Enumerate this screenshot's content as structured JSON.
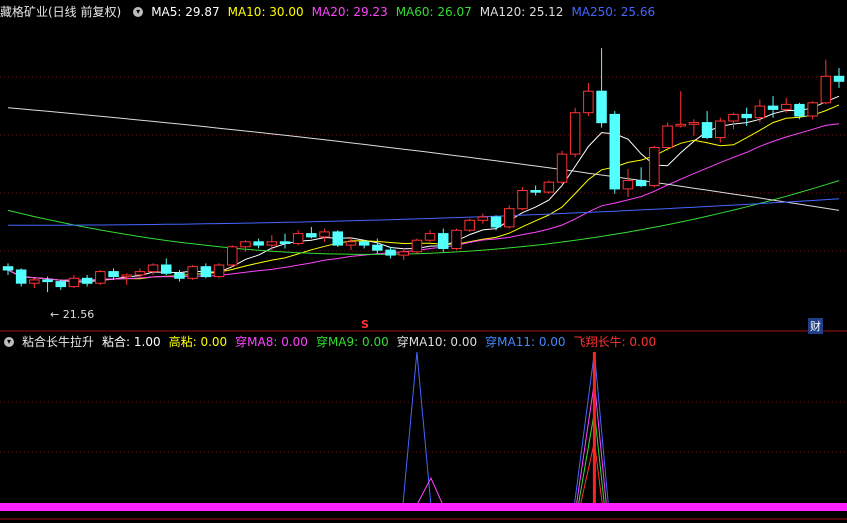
{
  "top_panel": {
    "title": "藏格矿业(日线 前复权)",
    "ma_items": [
      {
        "label": "MA5: 29.87",
        "color": "#ffffff"
      },
      {
        "label": "MA10: 30.00",
        "color": "#ffff00"
      },
      {
        "label": "MA20: 29.23",
        "color": "#ff44ff"
      },
      {
        "label": "MA60: 26.07",
        "color": "#33dd33"
      },
      {
        "label": "MA120: 25.12",
        "color": "#dddddd"
      },
      {
        "label": "MA250: 25.66",
        "color": "#4466ff"
      }
    ],
    "low_label": "← 21.56",
    "marker_s": "S",
    "marker_cai": "财"
  },
  "bottom_panel": {
    "title": "粘合长牛拉升",
    "items": [
      {
        "label": "粘合: 1.00",
        "color": "#ffffff"
      },
      {
        "label": "高粘: 0.00",
        "color": "#ffff00"
      },
      {
        "label": "穿MA8: 0.00",
        "color": "#ff44ff"
      },
      {
        "label": "穿MA9: 0.00",
        "color": "#33dd33"
      },
      {
        "label": "穿MA10: 0.00",
        "color": "#dddddd"
      },
      {
        "label": "穿MA11: 0.00",
        "color": "#4488ff"
      },
      {
        "label": "飞翔长牛: 0.00",
        "color": "#ff3333"
      }
    ]
  },
  "chart_data": {
    "type": "candlestick",
    "ylim": [
      20,
      38
    ],
    "candles": [
      [
        23.1,
        23.3,
        22.6,
        22.9
      ],
      [
        22.9,
        23.0,
        21.9,
        22.1
      ],
      [
        22.1,
        22.4,
        21.8,
        22.3
      ],
      [
        22.3,
        22.5,
        21.56,
        22.2
      ],
      [
        22.2,
        22.3,
        21.7,
        21.9
      ],
      [
        21.9,
        22.6,
        21.8,
        22.4
      ],
      [
        22.4,
        22.6,
        21.9,
        22.1
      ],
      [
        22.1,
        22.9,
        22.0,
        22.8
      ],
      [
        22.8,
        23.0,
        22.3,
        22.5
      ],
      [
        22.5,
        22.7,
        22.0,
        22.6
      ],
      [
        22.6,
        23.0,
        22.4,
        22.8
      ],
      [
        22.8,
        23.3,
        22.6,
        23.2
      ],
      [
        23.2,
        23.6,
        22.6,
        22.7
      ],
      [
        22.7,
        22.9,
        22.2,
        22.4
      ],
      [
        22.4,
        23.2,
        22.3,
        23.1
      ],
      [
        23.1,
        23.3,
        22.4,
        22.5
      ],
      [
        22.5,
        23.3,
        22.4,
        23.2
      ],
      [
        23.2,
        24.4,
        23.1,
        24.3
      ],
      [
        24.3,
        24.7,
        24.0,
        24.6
      ],
      [
        24.6,
        24.8,
        24.2,
        24.4
      ],
      [
        24.4,
        25.0,
        24.1,
        24.6
      ],
      [
        24.6,
        25.1,
        24.2,
        24.5
      ],
      [
        24.5,
        25.3,
        24.4,
        25.1
      ],
      [
        25.1,
        25.5,
        24.8,
        24.9
      ],
      [
        24.9,
        25.4,
        24.6,
        25.2
      ],
      [
        25.2,
        25.3,
        24.3,
        24.4
      ],
      [
        24.4,
        24.9,
        24.1,
        24.6
      ],
      [
        24.6,
        24.7,
        24.2,
        24.4
      ],
      [
        24.4,
        24.8,
        23.9,
        24.1
      ],
      [
        24.1,
        24.3,
        23.6,
        23.8
      ],
      [
        23.8,
        24.2,
        23.5,
        24.0
      ],
      [
        24.0,
        24.8,
        23.9,
        24.7
      ],
      [
        24.7,
        25.3,
        24.6,
        25.1
      ],
      [
        25.1,
        25.4,
        24.0,
        24.2
      ],
      [
        24.2,
        25.4,
        24.1,
        25.3
      ],
      [
        25.3,
        26.0,
        25.2,
        25.9
      ],
      [
        25.9,
        26.3,
        25.7,
        26.1
      ],
      [
        26.1,
        26.2,
        25.3,
        25.5
      ],
      [
        25.5,
        26.8,
        25.4,
        26.6
      ],
      [
        26.6,
        27.9,
        26.5,
        27.7
      ],
      [
        27.7,
        28.0,
        27.4,
        27.6
      ],
      [
        27.6,
        28.3,
        27.5,
        28.2
      ],
      [
        28.2,
        30.1,
        28.1,
        29.9
      ],
      [
        29.9,
        32.7,
        29.7,
        32.4
      ],
      [
        32.4,
        34.2,
        32.2,
        33.7
      ],
      [
        33.7,
        36.3,
        31.5,
        31.8
      ],
      [
        32.3,
        32.5,
        27.5,
        27.8
      ],
      [
        27.8,
        29.0,
        27.3,
        28.3
      ],
      [
        28.3,
        29.1,
        27.9,
        28.0
      ],
      [
        28.0,
        30.4,
        27.9,
        30.3
      ],
      [
        30.3,
        31.8,
        30.1,
        31.6
      ],
      [
        31.6,
        33.7,
        31.5,
        31.7
      ],
      [
        31.7,
        32.0,
        31.0,
        31.8
      ],
      [
        31.8,
        32.5,
        30.8,
        30.9
      ],
      [
        30.9,
        32.1,
        30.6,
        31.9
      ],
      [
        31.9,
        32.4,
        31.4,
        32.3
      ],
      [
        32.3,
        32.7,
        31.6,
        32.1
      ],
      [
        32.1,
        33.2,
        31.8,
        32.8
      ],
      [
        32.8,
        33.4,
        32.1,
        32.6
      ],
      [
        32.6,
        33.3,
        32.4,
        32.9
      ],
      [
        32.9,
        33.0,
        32.0,
        32.2
      ],
      [
        32.2,
        33.1,
        32.0,
        33.0
      ],
      [
        33.0,
        35.6,
        32.9,
        34.6
      ],
      [
        34.6,
        35.1,
        33.9,
        34.3
      ]
    ],
    "bottom_spike_columns": [
      31,
      44,
      45
    ]
  }
}
